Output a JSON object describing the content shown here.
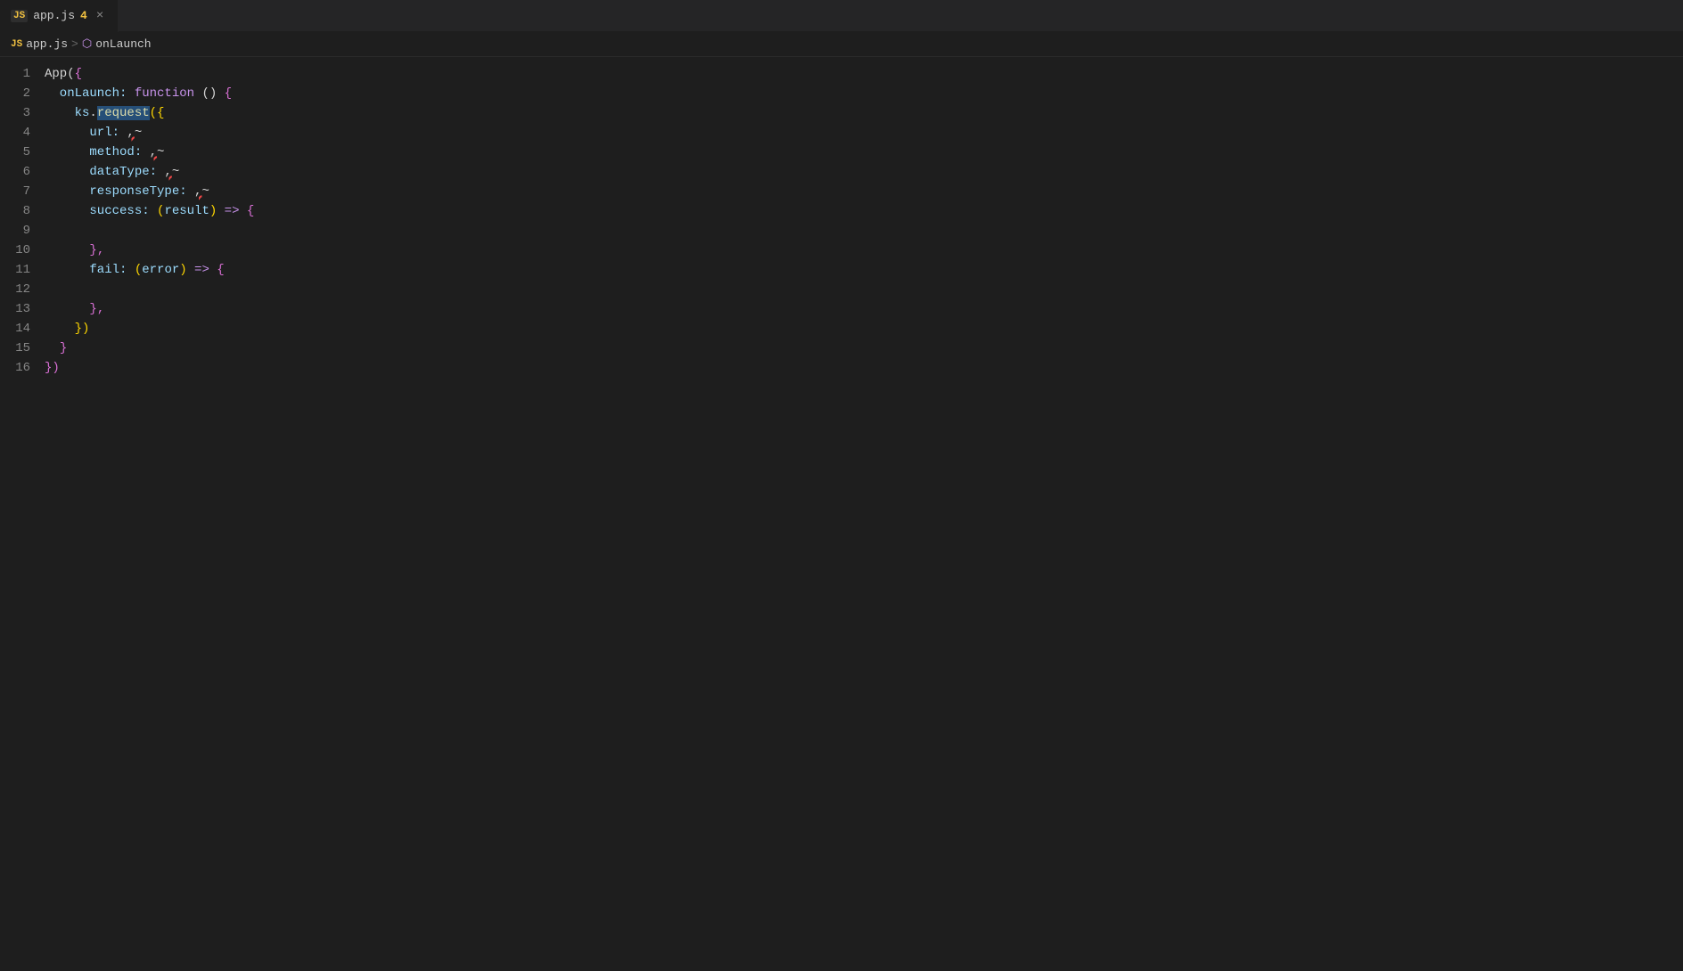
{
  "tab": {
    "js_icon": "JS",
    "filename": "app.js",
    "modified_count": "4",
    "close_icon": "×"
  },
  "breadcrumb": {
    "js_icon": "JS",
    "file": "app.js",
    "separator": ">",
    "func_icon": "⬡",
    "func_name": "onLaunch"
  },
  "lines": [
    {
      "num": "1",
      "tokens": [
        {
          "t": "App(",
          "c": "c-white"
        },
        {
          "t": "{",
          "c": "c-bracket"
        }
      ]
    },
    {
      "num": "2",
      "tokens": [
        {
          "t": "  onLaunch: ",
          "c": "c-prop"
        },
        {
          "t": "function",
          "c": "c-keyword"
        },
        {
          "t": " () ",
          "c": "c-white"
        },
        {
          "t": "{",
          "c": "c-bracket"
        }
      ]
    },
    {
      "num": "3",
      "tokens": [
        {
          "t": "    ks",
          "c": "c-blue"
        },
        {
          "t": ".",
          "c": "c-white"
        },
        {
          "t": "request",
          "c": "c-func",
          "highlight": true
        },
        {
          "t": "({",
          "c": "c-paren"
        }
      ],
      "highlight_word": "request"
    },
    {
      "num": "4",
      "tokens": [
        {
          "t": "      url: ",
          "c": "c-prop"
        },
        {
          "t": ",",
          "c": "c-white"
        },
        {
          "t": "~",
          "c": "squiggle-red"
        }
      ]
    },
    {
      "num": "5",
      "tokens": [
        {
          "t": "      method: ",
          "c": "c-prop"
        },
        {
          "t": ",",
          "c": "c-white"
        },
        {
          "t": "~",
          "c": "squiggle-red"
        }
      ]
    },
    {
      "num": "6",
      "tokens": [
        {
          "t": "      dataType: ",
          "c": "c-prop"
        },
        {
          "t": ",",
          "c": "c-white"
        },
        {
          "t": "~",
          "c": "squiggle-red"
        }
      ]
    },
    {
      "num": "7",
      "tokens": [
        {
          "t": "      responseType: ",
          "c": "c-prop"
        },
        {
          "t": ",",
          "c": "c-white"
        },
        {
          "t": "~",
          "c": "squiggle-red"
        }
      ]
    },
    {
      "num": "8",
      "tokens": [
        {
          "t": "      success: ",
          "c": "c-prop"
        },
        {
          "t": "(",
          "c": "c-paren"
        },
        {
          "t": "result",
          "c": "c-param"
        },
        {
          "t": ")",
          "c": "c-paren"
        },
        {
          "t": " => ",
          "c": "c-arrow"
        },
        {
          "t": "{",
          "c": "c-bracket"
        }
      ]
    },
    {
      "num": "9",
      "tokens": []
    },
    {
      "num": "10",
      "tokens": [
        {
          "t": "      ",
          "c": "c-white"
        },
        {
          "t": "},",
          "c": "c-bracket"
        }
      ]
    },
    {
      "num": "11",
      "tokens": [
        {
          "t": "      fail: ",
          "c": "c-prop"
        },
        {
          "t": "(",
          "c": "c-paren"
        },
        {
          "t": "error",
          "c": "c-param"
        },
        {
          "t": ")",
          "c": "c-paren"
        },
        {
          "t": " => ",
          "c": "c-arrow"
        },
        {
          "t": "{",
          "c": "c-bracket"
        }
      ]
    },
    {
      "num": "12",
      "tokens": []
    },
    {
      "num": "13",
      "tokens": [
        {
          "t": "      ",
          "c": "c-white"
        },
        {
          "t": "},",
          "c": "c-bracket"
        }
      ]
    },
    {
      "num": "14",
      "tokens": [
        {
          "t": "    ",
          "c": "c-white"
        },
        {
          "t": "})",
          "c": "c-paren"
        }
      ]
    },
    {
      "num": "15",
      "tokens": [
        {
          "t": "  ",
          "c": "c-white"
        },
        {
          "t": "}",
          "c": "c-bracket"
        }
      ]
    },
    {
      "num": "16",
      "tokens": [
        {
          "t": "})",
          "c": "c-bracket"
        }
      ]
    }
  ]
}
